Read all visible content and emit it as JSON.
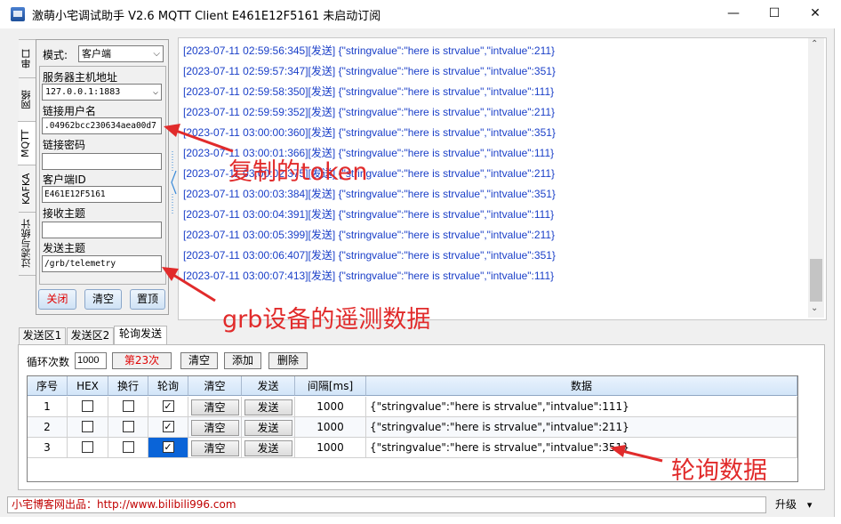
{
  "window": {
    "title": "激萌小宅调试助手 V2.6 MQTT Client E461E12F5161 未启动订阅",
    "min_glyph": "—",
    "max_glyph": "☐",
    "close_glyph": "✕"
  },
  "side_tabs": [
    "串口",
    "网络",
    "MQTT",
    "KAFKA",
    "过滤与统计"
  ],
  "side_tab_selected": "MQTT",
  "connection": {
    "mode_label": "模式:",
    "mode_value": "客户端",
    "server_label": "服务器主机地址",
    "server_value": "127.0.0.1:1883",
    "username_label": "链接用户名",
    "username_value": ".04962bcc230634aea00d7",
    "password_label": "链接密码",
    "password_value": "",
    "client_id_label": "客户端ID",
    "client_id_value": "E461E12F5161",
    "sub_topic_label": "接收主题",
    "sub_topic_value": "",
    "pub_topic_label": "发送主题",
    "pub_topic_value": "/grb/telemetry",
    "close_button": "关闭",
    "clear_button": "清空",
    "pin_button": "置顶"
  },
  "log": {
    "lines": [
      "[2023-07-11 02:59:56:345][发送] {\"stringvalue\":\"here is strvalue\",\"intvalue\":211}",
      "[2023-07-11 02:59:57:347][发送] {\"stringvalue\":\"here is strvalue\",\"intvalue\":351}",
      "[2023-07-11 02:59:58:350][发送] {\"stringvalue\":\"here is strvalue\",\"intvalue\":111}",
      "[2023-07-11 02:59:59:352][发送] {\"stringvalue\":\"here is strvalue\",\"intvalue\":211}",
      "[2023-07-11 03:00:00:360][发送] {\"stringvalue\":\"here is strvalue\",\"intvalue\":351}",
      "[2023-07-11 03:00:01:366][发送] {\"stringvalue\":\"here is strvalue\",\"intvalue\":111}",
      "[2023-07-11 03:00:02:375][发送] {\"stringvalue\":\"here is strvalue\",\"intvalue\":211}",
      "[2023-07-11 03:00:03:384][发送] {\"stringvalue\":\"here is strvalue\",\"intvalue\":351}",
      "[2023-07-11 03:00:04:391][发送] {\"stringvalue\":\"here is strvalue\",\"intvalue\":111}",
      "[2023-07-11 03:00:05:399][发送] {\"stringvalue\":\"here is strvalue\",\"intvalue\":211}",
      "[2023-07-11 03:00:06:407][发送] {\"stringvalue\":\"here is strvalue\",\"intvalue\":351}",
      "[2023-07-11 03:00:07:413][发送] {\"stringvalue\":\"here is strvalue\",\"intvalue\":111}"
    ]
  },
  "bottom_tabs": [
    "发送区1",
    "发送区2",
    "轮询发送"
  ],
  "bottom_tab_selected": "轮询发送",
  "poll": {
    "loop_label": "循环次数",
    "loop_value": "1000",
    "counter_label": "第23次",
    "clear_button": "清空",
    "add_button": "添加",
    "delete_button": "删除",
    "columns": [
      "序号",
      "HEX",
      "换行",
      "轮询",
      "清空",
      "发送",
      "间隔[ms]",
      "数据"
    ],
    "rows": [
      {
        "index": "1",
        "hex": false,
        "newline": false,
        "poll": true,
        "clear": "清空",
        "send": "发送",
        "interval": "1000",
        "data": "{\"stringvalue\":\"here is strvalue\",\"intvalue\":111}"
      },
      {
        "index": "2",
        "hex": false,
        "newline": false,
        "poll": true,
        "clear": "清空",
        "send": "发送",
        "interval": "1000",
        "data": "{\"stringvalue\":\"here is strvalue\",\"intvalue\":211}"
      },
      {
        "index": "3",
        "hex": false,
        "newline": false,
        "poll": true,
        "clear": "清空",
        "send": "发送",
        "interval": "1000",
        "data": "{\"stringvalue\":\"here is strvalue\",\"intvalue\":351}"
      }
    ]
  },
  "status": {
    "text": "小宅博客网出品：http://www.bilibili996.com",
    "upgrade_label": "升级",
    "upgrade_arrow": "▾"
  },
  "annotations": {
    "token": "复制的token",
    "telemetry": "grb设备的遥测数据",
    "poll_data": "轮询数据"
  },
  "colors": {
    "log_text": "#1a3fc8",
    "annotation": "#e12b2b",
    "status_text": "#c00000",
    "counter_text": "#e00000"
  }
}
